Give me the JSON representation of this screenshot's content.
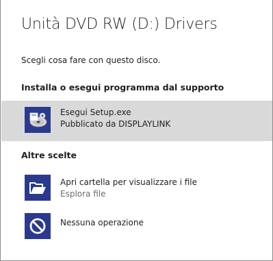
{
  "dialog": {
    "title": "Unità DVD RW (D:) Drivers",
    "prompt": "Scegli cosa fare con questo disco."
  },
  "sections": [
    {
      "header": "Installa o esegui programma dal supporto"
    },
    {
      "header": "Altre scelte"
    }
  ],
  "options": [
    {
      "label": "Esegui Setup.exe",
      "detail": "Pubblicato da DISPLAYLINK",
      "icon": "setup-disc-icon",
      "selected": true
    },
    {
      "label": "Apri cartella per visualizzare i file",
      "detail": "Esplora file",
      "icon": "folder-open-icon",
      "selected": false
    },
    {
      "label": "Nessuna operazione",
      "icon": "no-action-icon",
      "selected": false
    }
  ],
  "colors": {
    "icon_tile": "#2b3a8f",
    "selected_bg": "#d9d9d9",
    "secondary_text": "#6b6b6b"
  }
}
